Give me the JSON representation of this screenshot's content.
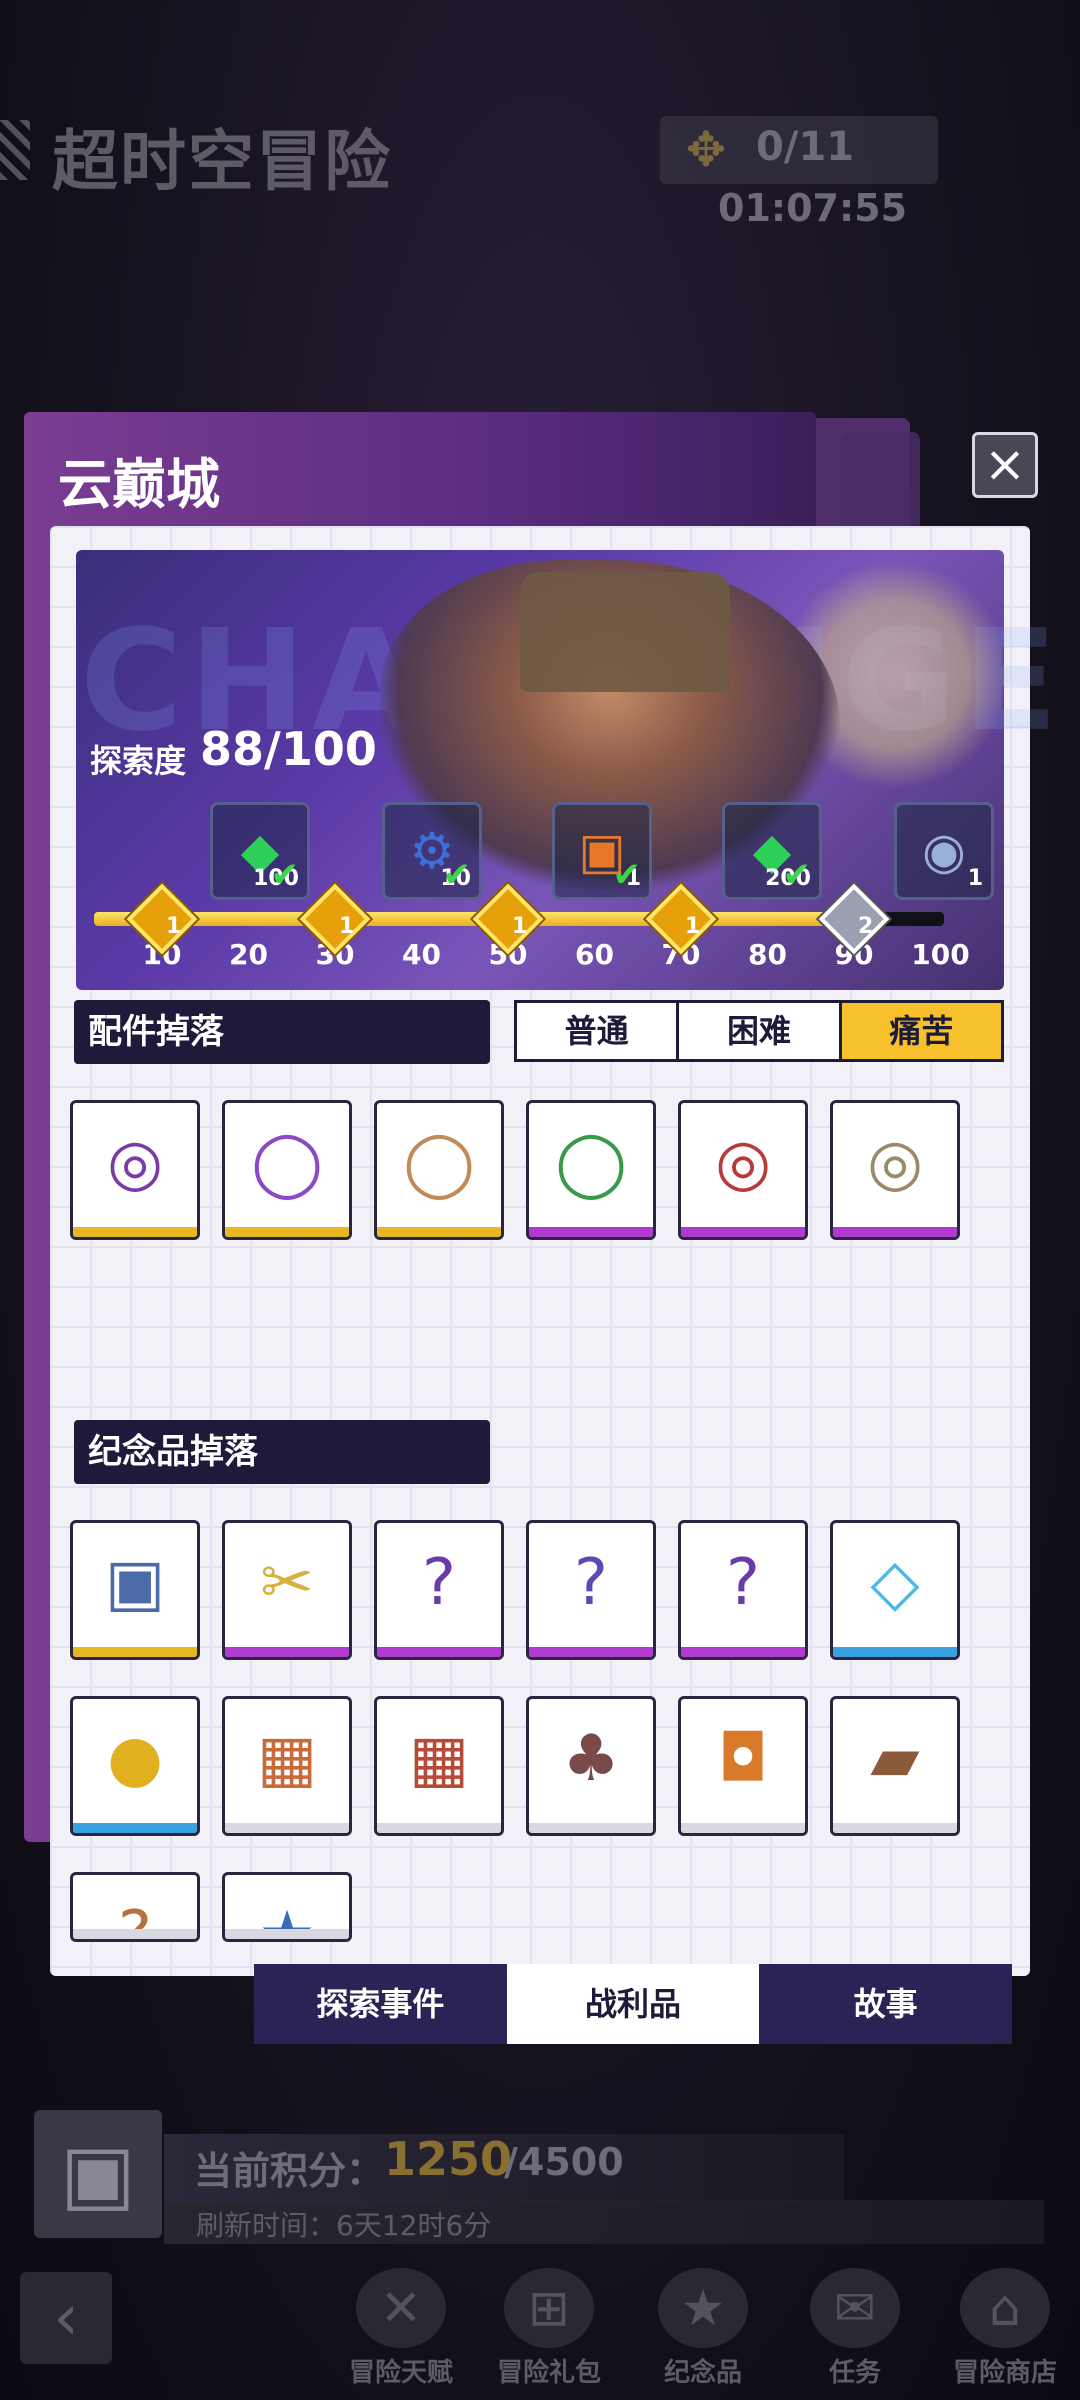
{
  "background": {
    "title": "超时空冒险",
    "key_count": "0/11",
    "timer": "01:07:55"
  },
  "modal": {
    "title": "云巅城",
    "close_icon": "×",
    "banner_ghost_text": "CHALLENGE",
    "explore_label": "探索度",
    "explore_value": "88/100",
    "progress_fraction": 0.88,
    "rewards": [
      {
        "icon": "green-gem",
        "glyph": "◆",
        "color": "#2fd05a",
        "num": "100",
        "done": true
      },
      {
        "icon": "gear",
        "glyph": "⚙",
        "color": "#3d6fd8",
        "num": "10",
        "done": true
      },
      {
        "icon": "treasure-chest",
        "glyph": "▣",
        "color": "#e8782a",
        "num": "1",
        "done": true
      },
      {
        "icon": "green-gem",
        "glyph": "◆",
        "color": "#2fd05a",
        "num": "200",
        "done": true
      },
      {
        "icon": "medal",
        "glyph": "◉",
        "color": "#9ab0d8",
        "num": "1",
        "done": false
      }
    ],
    "milestones": [
      {
        "tick": "10",
        "node": true,
        "node_num": "1"
      },
      {
        "tick": "20",
        "node": false
      },
      {
        "tick": "30",
        "node": true,
        "node_num": "1"
      },
      {
        "tick": "40",
        "node": false
      },
      {
        "tick": "50",
        "node": true,
        "node_num": "1"
      },
      {
        "tick": "60",
        "node": false
      },
      {
        "tick": "70",
        "node": true,
        "node_num": "1"
      },
      {
        "tick": "80",
        "node": false
      },
      {
        "tick": "90",
        "node": true,
        "node_num": "2",
        "silver": true
      },
      {
        "tick": "100",
        "node": false
      }
    ],
    "parts_header": "配件掉落",
    "difficulty_tabs": [
      "普通",
      "困难",
      "痛苦"
    ],
    "difficulty_selected": "痛苦",
    "parts": [
      {
        "name": "beyblade-purple-gold",
        "glyph": "◎",
        "color": "#7a3aa8",
        "rarity": "gold"
      },
      {
        "name": "ring-purple-gold",
        "glyph": "◯",
        "color": "#8a4ac8",
        "rarity": "gold"
      },
      {
        "name": "ring-copper",
        "glyph": "◯",
        "color": "#c08a5a",
        "rarity": "gold"
      },
      {
        "name": "ring-green-silver",
        "glyph": "◯",
        "color": "#3a9a4a",
        "rarity": "purple"
      },
      {
        "name": "beyblade-red-silver",
        "glyph": "◎",
        "color": "#b83a3a",
        "rarity": "purple"
      },
      {
        "name": "beyblade-gold-steel",
        "glyph": "◎",
        "color": "#9a8a6a",
        "rarity": "purple"
      }
    ],
    "souvenirs_header": "纪念品掉落",
    "souvenirs": [
      {
        "name": "blue-chest",
        "glyph": "▣",
        "color": "#4a6aa8",
        "rarity": "gold"
      },
      {
        "name": "scissors",
        "glyph": "✂",
        "color": "#d8b040",
        "rarity": "purple"
      },
      {
        "name": "mystery-food-bag",
        "glyph": "?",
        "color": "#6a3aa8",
        "rarity": "purple"
      },
      {
        "name": "mystery-orb",
        "glyph": "?",
        "color": "#5a4ab8",
        "rarity": "purple"
      },
      {
        "name": "mystery-food-bag",
        "glyph": "?",
        "color": "#6a3aa8",
        "rarity": "purple"
      },
      {
        "name": "crystal-card",
        "glyph": "◇",
        "color": "#4ab8e8",
        "rarity": "blue"
      },
      {
        "name": "gold-coin",
        "glyph": "●",
        "color": "#e0b020",
        "rarity": "blue"
      },
      {
        "name": "fish-basket",
        "glyph": "▦",
        "color": "#c86a3a",
        "rarity": "white"
      },
      {
        "name": "food-basket",
        "glyph": "▦",
        "color": "#b84a3a",
        "rarity": "white"
      },
      {
        "name": "cupcake",
        "glyph": "♣",
        "color": "#7a4a4a",
        "rarity": "white"
      },
      {
        "name": "camera",
        "glyph": "◘",
        "color": "#d87a2a",
        "rarity": "white"
      },
      {
        "name": "cutting-board",
        "glyph": "▰",
        "color": "#8a5a3a",
        "rarity": "white"
      },
      {
        "name": "mystery-block",
        "glyph": "?",
        "color": "#b8703a",
        "rarity": "white"
      },
      {
        "name": "star-badge",
        "glyph": "★",
        "color": "#3a6ab8",
        "rarity": "white"
      }
    ],
    "bottom_tabs": [
      "探索事件",
      "战利品",
      "故事"
    ],
    "bottom_selected": "战利品"
  },
  "footer": {
    "score_label": "当前积分：",
    "score_current": "1250",
    "score_total": "/4500",
    "refresh_text": "刷新时间：6天12时6分",
    "nav": [
      {
        "label": "冒险天赋",
        "icon": "dna-icon",
        "glyph": "✕"
      },
      {
        "label": "冒险礼包",
        "icon": "gift-icon",
        "glyph": "⊞"
      },
      {
        "label": "纪念品",
        "icon": "star-badge-icon",
        "glyph": "★"
      },
      {
        "label": "任务",
        "icon": "envelope-icon",
        "glyph": "✉"
      },
      {
        "label": "冒险商店",
        "icon": "shop-icon",
        "glyph": "⌂"
      }
    ]
  }
}
